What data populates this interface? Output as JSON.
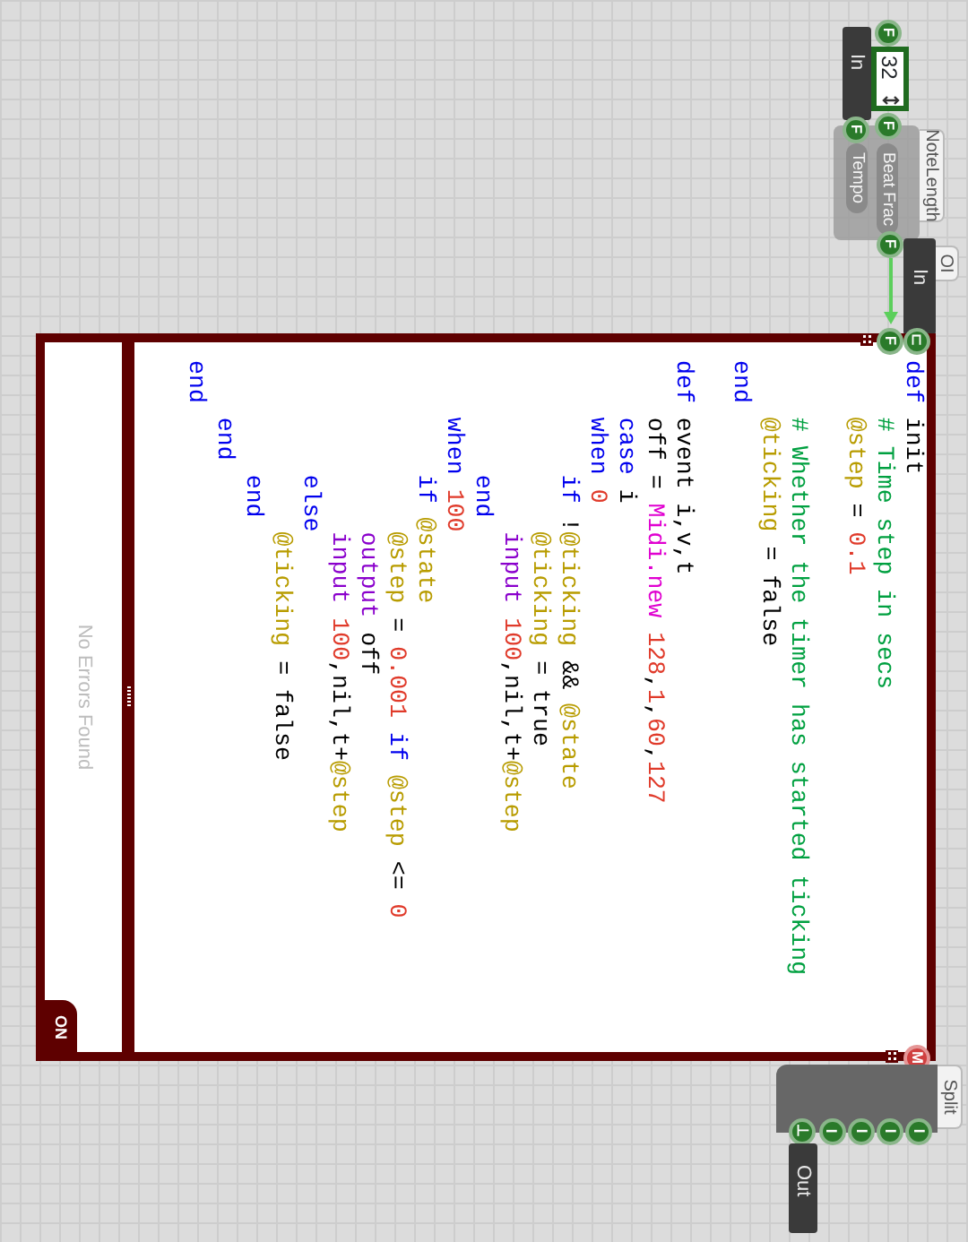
{
  "in_node": {
    "label": "In",
    "ports": [
      {
        "glyph": "F",
        "color": "#2a7a2a"
      }
    ]
  },
  "number_box": {
    "value": "32",
    "ports": [
      {
        "glyph": "F",
        "color": "#2a7a2a"
      },
      {
        "glyph": "F",
        "color": "#2a7a2a"
      }
    ]
  },
  "note_length": {
    "title": "NoteLength",
    "inputs": [
      "Beat Frac",
      "Tempo"
    ],
    "ports": [
      {
        "glyph": "F",
        "color": "#2a7a2a"
      }
    ]
  },
  "io_node": {
    "title": "OI",
    "label": "In"
  },
  "editor": {
    "inputs": [
      {
        "glyph": "⊏",
        "color": "#2a7a2a"
      },
      {
        "glyph": "F",
        "color": "#2a7a2a"
      }
    ],
    "outputs": [
      {
        "glyph": "M",
        "color": "#d04040"
      }
    ],
    "code": [
      {
        "tokens": [
          {
            "text": "def",
            "kind": "keyword"
          },
          {
            "text": " init",
            "kind": "plain"
          }
        ]
      },
      {
        "tokens": [
          {
            "text": "    # Time step in secs",
            "kind": "comment"
          }
        ]
      },
      {
        "tokens": [
          {
            "text": "    @step",
            "kind": "ivar"
          },
          {
            "text": " = ",
            "kind": "plain"
          },
          {
            "text": "0.1",
            "kind": "number"
          }
        ]
      },
      {
        "kind": "blank"
      },
      {
        "tokens": [
          {
            "text": "    # Whether the timer has started ticking",
            "kind": "comment"
          }
        ]
      },
      {
        "tokens": [
          {
            "text": "    @ticking",
            "kind": "ivar"
          },
          {
            "text": " = false",
            "kind": "plain"
          }
        ]
      },
      {
        "tokens": [
          {
            "text": "end",
            "kind": "keyword"
          }
        ]
      },
      {
        "kind": "blank"
      },
      {
        "tokens": [
          {
            "text": "def",
            "kind": "keyword"
          },
          {
            "text": " event i,v,t",
            "kind": "plain"
          }
        ]
      },
      {
        "tokens": [
          {
            "text": "    off = ",
            "kind": "plain"
          },
          {
            "text": "Midi.new",
            "kind": "constant"
          },
          {
            "text": " 128",
            "kind": "number"
          },
          {
            "text": ",",
            "kind": "plain"
          },
          {
            "text": "1",
            "kind": "number"
          },
          {
            "text": ",",
            "kind": "plain"
          },
          {
            "text": "60",
            "kind": "number"
          },
          {
            "text": ",",
            "kind": "plain"
          },
          {
            "text": "127",
            "kind": "number"
          }
        ]
      },
      {
        "tokens": [
          {
            "text": "    case",
            "kind": "keyword"
          },
          {
            "text": " i",
            "kind": "plain"
          }
        ]
      },
      {
        "tokens": [
          {
            "text": "    when",
            "kind": "keyword"
          },
          {
            "text": " 0",
            "kind": "number"
          }
        ]
      },
      {
        "tokens": [
          {
            "text": "        if",
            "kind": "keyword"
          },
          {
            "text": " !",
            "kind": "plain"
          },
          {
            "text": "@ticking",
            "kind": "ivar"
          },
          {
            "text": " && ",
            "kind": "plain"
          },
          {
            "text": "@state",
            "kind": "ivar"
          }
        ]
      },
      {
        "tokens": [
          {
            "text": "            @ticking",
            "kind": "ivar"
          },
          {
            "text": " = true",
            "kind": "plain"
          }
        ]
      },
      {
        "tokens": [
          {
            "text": "            input",
            "kind": "method"
          },
          {
            "text": " 100",
            "kind": "number"
          },
          {
            "text": ",nil,t+",
            "kind": "plain"
          },
          {
            "text": "@step",
            "kind": "ivar"
          }
        ]
      },
      {
        "tokens": [
          {
            "text": "        end",
            "kind": "keyword"
          }
        ]
      },
      {
        "tokens": [
          {
            "text": "    when",
            "kind": "keyword"
          },
          {
            "text": " 100",
            "kind": "number"
          }
        ]
      },
      {
        "tokens": [
          {
            "text": "        if",
            "kind": "keyword"
          },
          {
            "text": " @state",
            "kind": "ivar"
          }
        ]
      },
      {
        "tokens": [
          {
            "text": "            @step",
            "kind": "ivar"
          },
          {
            "text": " = ",
            "kind": "plain"
          },
          {
            "text": "0.001",
            "kind": "number"
          },
          {
            "text": " if",
            "kind": "keyword"
          },
          {
            "text": " @step",
            "kind": "ivar"
          },
          {
            "text": " <= ",
            "kind": "plain"
          },
          {
            "text": "0",
            "kind": "number"
          }
        ]
      },
      {
        "tokens": [
          {
            "text": "            output",
            "kind": "method"
          },
          {
            "text": " off",
            "kind": "plain"
          }
        ]
      },
      {
        "tokens": [
          {
            "text": "            input",
            "kind": "method"
          },
          {
            "text": " 100",
            "kind": "number"
          },
          {
            "text": ",nil,t+",
            "kind": "plain"
          },
          {
            "text": "@step",
            "kind": "ivar"
          }
        ]
      },
      {
        "tokens": [
          {
            "text": "        else",
            "kind": "keyword"
          }
        ]
      },
      {
        "tokens": [
          {
            "text": "            @ticking",
            "kind": "ivar"
          },
          {
            "text": " = false",
            "kind": "plain"
          }
        ]
      },
      {
        "tokens": [
          {
            "text": "        end",
            "kind": "keyword"
          }
        ]
      },
      {
        "tokens": [
          {
            "text": "    end",
            "kind": "keyword"
          }
        ]
      },
      {
        "tokens": [
          {
            "text": "end",
            "kind": "keyword"
          }
        ]
      }
    ],
    "errors": "No Errors Found",
    "toggle": "ON"
  },
  "split": {
    "title": "Split",
    "outputs": [
      {
        "glyph": "I",
        "color": "#2a7a2a"
      },
      {
        "glyph": "I",
        "color": "#2a7a2a"
      },
      {
        "glyph": "I",
        "color": "#2a7a2a"
      },
      {
        "glyph": "I",
        "color": "#2a7a2a"
      },
      {
        "glyph": "⊥",
        "color": "#2a7a2a"
      }
    ]
  },
  "out_node": {
    "label": "Out"
  }
}
